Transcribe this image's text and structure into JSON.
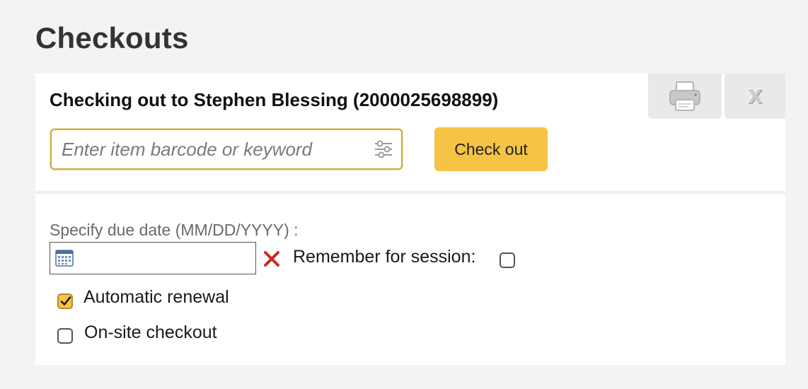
{
  "page": {
    "title": "Checkouts"
  },
  "checkout": {
    "heading": "Checking out to Stephen Blessing (2000025698899)",
    "barcode_placeholder": "Enter item barcode or keyword",
    "barcode_value": "",
    "checkout_button_label": "Check out"
  },
  "toolbar": {
    "print_icon": "printer-icon",
    "close_label": "X"
  },
  "options": {
    "due_date_label": "Specify due date (MM/DD/YYYY) :",
    "due_date_value": "",
    "remember_label": "Remember for session:",
    "remember_checked": false,
    "auto_renewal_label": "Automatic renewal",
    "auto_renewal_checked": true,
    "onsite_label": "On-site checkout",
    "onsite_checked": false
  },
  "colors": {
    "accent": "#f5c445",
    "clear_icon": "#cc2b1d",
    "background": "#f3f3f3",
    "panel": "#ffffff"
  }
}
